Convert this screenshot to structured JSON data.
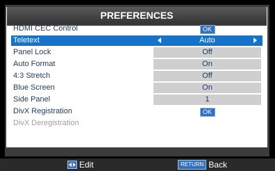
{
  "title": "PREFERENCES",
  "rows": [
    {
      "label": "HDMI CEC Control",
      "value": "OK"
    },
    {
      "label": "Teletext",
      "value": "Auto"
    },
    {
      "label": "Panel Lock",
      "value": "Off"
    },
    {
      "label": "Auto Format",
      "value": "On"
    },
    {
      "label": "4:3 Stretch",
      "value": "Off"
    },
    {
      "label": "Blue Screen",
      "value": "On"
    },
    {
      "label": "Side Panel",
      "value": "1"
    },
    {
      "label": "DivX Registration",
      "value": "OK"
    },
    {
      "label": "DivX Deregistration",
      "value": ""
    }
  ],
  "footer": {
    "edit_label": "Edit",
    "return_button": "RETURN",
    "back_label": "Back"
  },
  "colors": {
    "highlight": "#1474cd",
    "value_bg": "#cfcfcf",
    "text": "#1f3a5c"
  }
}
